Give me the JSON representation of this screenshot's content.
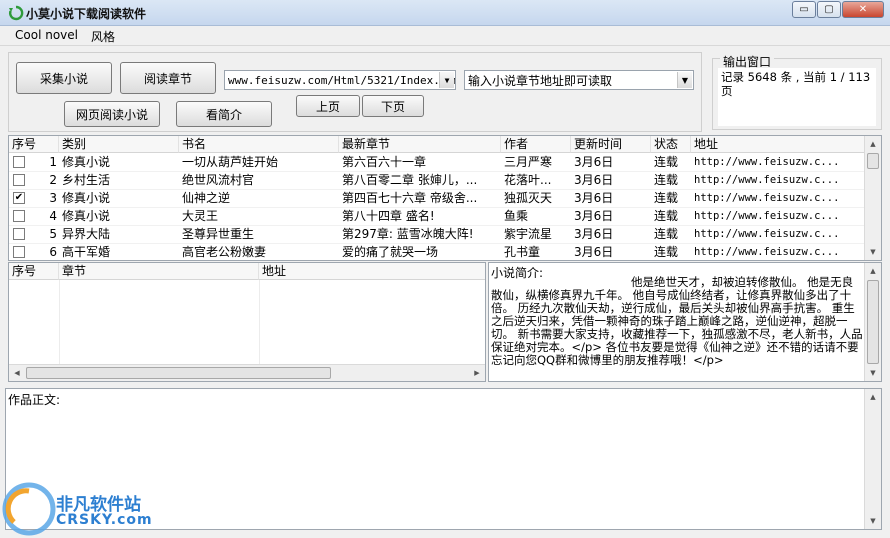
{
  "window": {
    "title": "小莫小说下载阅读软件",
    "min": "▭",
    "max": "▢",
    "close": "✕"
  },
  "menu": {
    "items": [
      "Cool novel",
      "风格"
    ]
  },
  "toolbar": {
    "collect": "采集小说",
    "read_chapter": "阅读章节",
    "web_read": "网页阅读小说",
    "view_intro": "看简介",
    "prev": "上页",
    "next": "下页",
    "url_value": "www.feisuzw.com/Html/5321/Index.htm",
    "chapter_hint": "输入小说章节地址即可读取"
  },
  "output": {
    "label": "输出窗口",
    "text": "记录 5648 条 , 当前 1 / 113 页"
  },
  "novel_table": {
    "headers": [
      "序号",
      "类别",
      "书名",
      "最新章节",
      "作者",
      "更新时间",
      "状态",
      "地址"
    ],
    "rows": [
      {
        "checked": false,
        "no": "1",
        "category": "修真小说",
        "title": "一切从葫芦娃开始",
        "latest": "第六百六十一章",
        "author": "三月严寒",
        "time": "3月6日",
        "status": "连载",
        "url": "http://www.feisuzw.c..."
      },
      {
        "checked": false,
        "no": "2",
        "category": "乡村生活",
        "title": "绝世风流村官",
        "latest": "第八百零二章 张婶儿，...",
        "author": "花落叶...",
        "time": "3月6日",
        "status": "连载",
        "url": "http://www.feisuzw.c..."
      },
      {
        "checked": true,
        "no": "3",
        "category": "修真小说",
        "title": "仙神之逆",
        "latest": "第四百七十六章 帝级舍...",
        "author": "独孤灭天",
        "time": "3月6日",
        "status": "连载",
        "url": "http://www.feisuzw.c..."
      },
      {
        "checked": false,
        "no": "4",
        "category": "修真小说",
        "title": "大灵王",
        "latest": "第八十四章 盛名!",
        "author": "鱼乘",
        "time": "3月6日",
        "status": "连载",
        "url": "http://www.feisuzw.c..."
      },
      {
        "checked": false,
        "no": "5",
        "category": "异界大陆",
        "title": "圣尊异世重生",
        "latest": "第297章: 蓝雪冰魄大阵!",
        "author": "紫宇流星",
        "time": "3月6日",
        "status": "连载",
        "url": "http://www.feisuzw.c..."
      },
      {
        "checked": false,
        "no": "6",
        "category": "高干军婚",
        "title": "高官老公粉嫩妻",
        "latest": "爱的痛了就哭一场",
        "author": "孔书童",
        "time": "3月6日",
        "status": "连载",
        "url": "http://www.feisuzw.c..."
      }
    ]
  },
  "chapter_table": {
    "headers": [
      "序号",
      "章节",
      "地址"
    ]
  },
  "intro": {
    "label": "小说简介:",
    "text": "他是绝世天才，却被迫转修散仙。 他是无良散仙，纵横修真界九千年。 他自号成仙终结者，让修真界散仙多出了十倍。 历经九次散仙天劫，逆行成仙，最后关头却被仙界高手抗害。 重生之后逆天归来，凭借一颗神奇的珠子踏上巅峰之路，逆仙逆神，超脱一切。 新书需要大家支持，收藏推荐一下，独孤感激不尽，老人新书，人品保证绝对完本。</p> 各位书友要是觉得《仙神之逆》还不错的话请不要忘记向您QQ群和微博里的朋友推荐哦！</p>"
  },
  "body_text": {
    "label": "作品正文:"
  },
  "watermark": {
    "cn": "非凡软件站",
    "en": "CRSKY.com"
  }
}
